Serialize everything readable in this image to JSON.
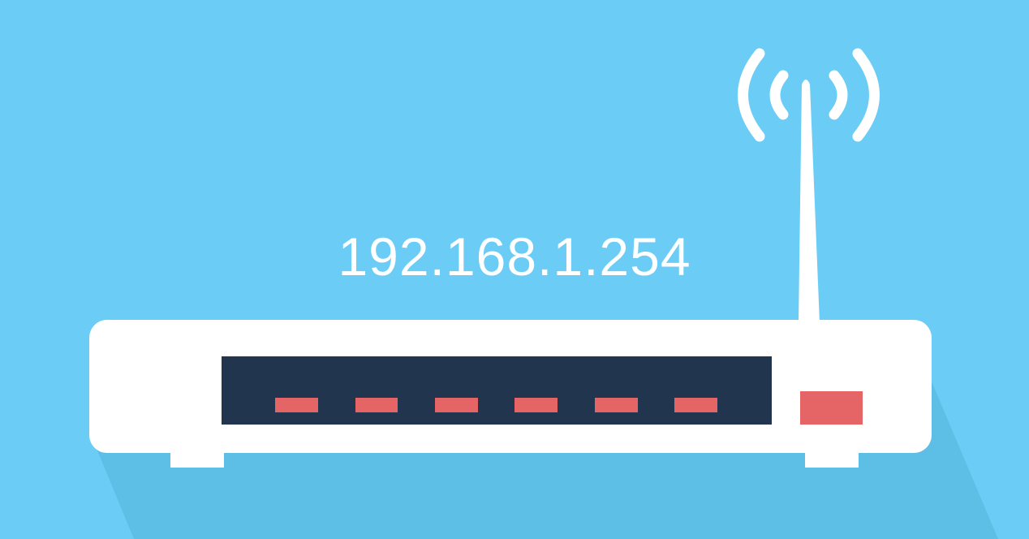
{
  "illustration": {
    "subject": "router-icon",
    "ip_address": "192.168.1.254",
    "port_count": 6,
    "colors": {
      "background": "#6bcdf5",
      "shadow": "#5ebfe6",
      "router_body": "#ffffff",
      "panel": "#22354f",
      "port_light": "#e56566",
      "antenna": "#ffffff"
    }
  }
}
